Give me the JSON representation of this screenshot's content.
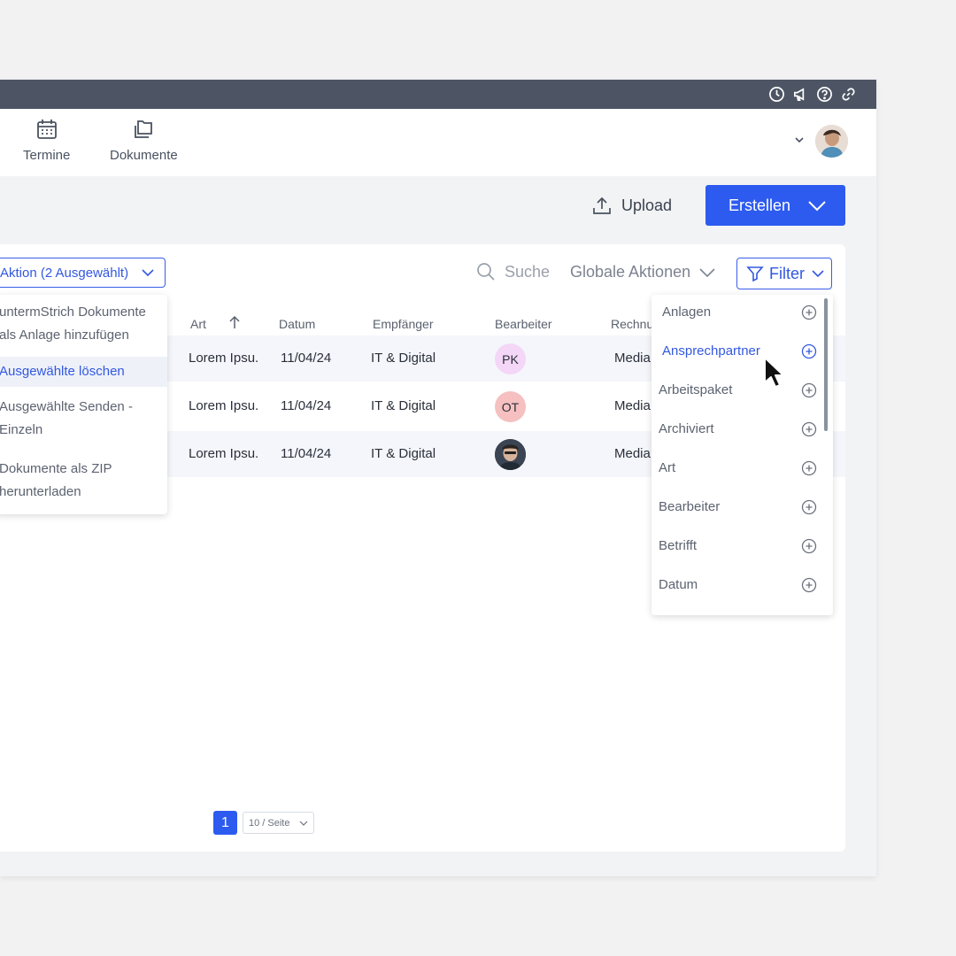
{
  "nav": {
    "items": [
      {
        "label": "Termine",
        "icon": "calendar-icon"
      },
      {
        "label": "Dokumente",
        "icon": "folders-icon"
      }
    ]
  },
  "topbar_icons": [
    "clock-icon",
    "megaphone-icon",
    "help-icon",
    "link-icon"
  ],
  "toolbar": {
    "upload_label": "Upload",
    "create_label": "Erstellen"
  },
  "table_toolbar": {
    "action_label": "Aktion (2 Ausgewählt)",
    "search_placeholder": "Suche",
    "global_actions_label": "Globale Aktionen",
    "filter_label": "Filter"
  },
  "table": {
    "columns": [
      "Art",
      "Datum",
      "Empfänger",
      "Bearbeiter",
      "Rechnu"
    ],
    "rows": [
      {
        "art": "Lorem Ipsu.",
        "datum": "11/04/24",
        "empfaenger": "IT & Digital",
        "bearbeiter": "PK",
        "rechnung": "Media"
      },
      {
        "art": "Lorem Ipsu.",
        "datum": "11/04/24",
        "empfaenger": "IT & Digital",
        "bearbeiter": "OT",
        "rechnung": "Media"
      },
      {
        "art": "Lorem Ipsu.",
        "datum": "11/04/24",
        "empfaenger": "IT & Digital",
        "bearbeiter": "",
        "rechnung": "Media"
      }
    ]
  },
  "action_menu": {
    "items": [
      {
        "line1": "untermStrich Dokumente",
        "line2": "als Anlage hinzufügen"
      },
      {
        "line1": "Ausgewählte löschen",
        "line2": ""
      },
      {
        "line1": "Ausgewählte Senden -",
        "line2": "Einzeln"
      },
      {
        "line1": "Dokumente als ZIP",
        "line2": "herunterladen"
      }
    ],
    "active_index": 1
  },
  "filter_menu": {
    "items": [
      "Anlagen",
      "Ansprechpartner",
      "Arbeitspaket",
      "Archiviert",
      "Art",
      "Bearbeiter",
      "Betrifft",
      "Datum"
    ],
    "active_index": 1
  },
  "pagination": {
    "current_page": "1",
    "page_size": "10 / Seite"
  },
  "colors": {
    "primary": "#2d5bf0",
    "topbar": "#4d5564",
    "badge_pk": "#f4d6f7",
    "badge_ot": "#f6c0c0"
  }
}
